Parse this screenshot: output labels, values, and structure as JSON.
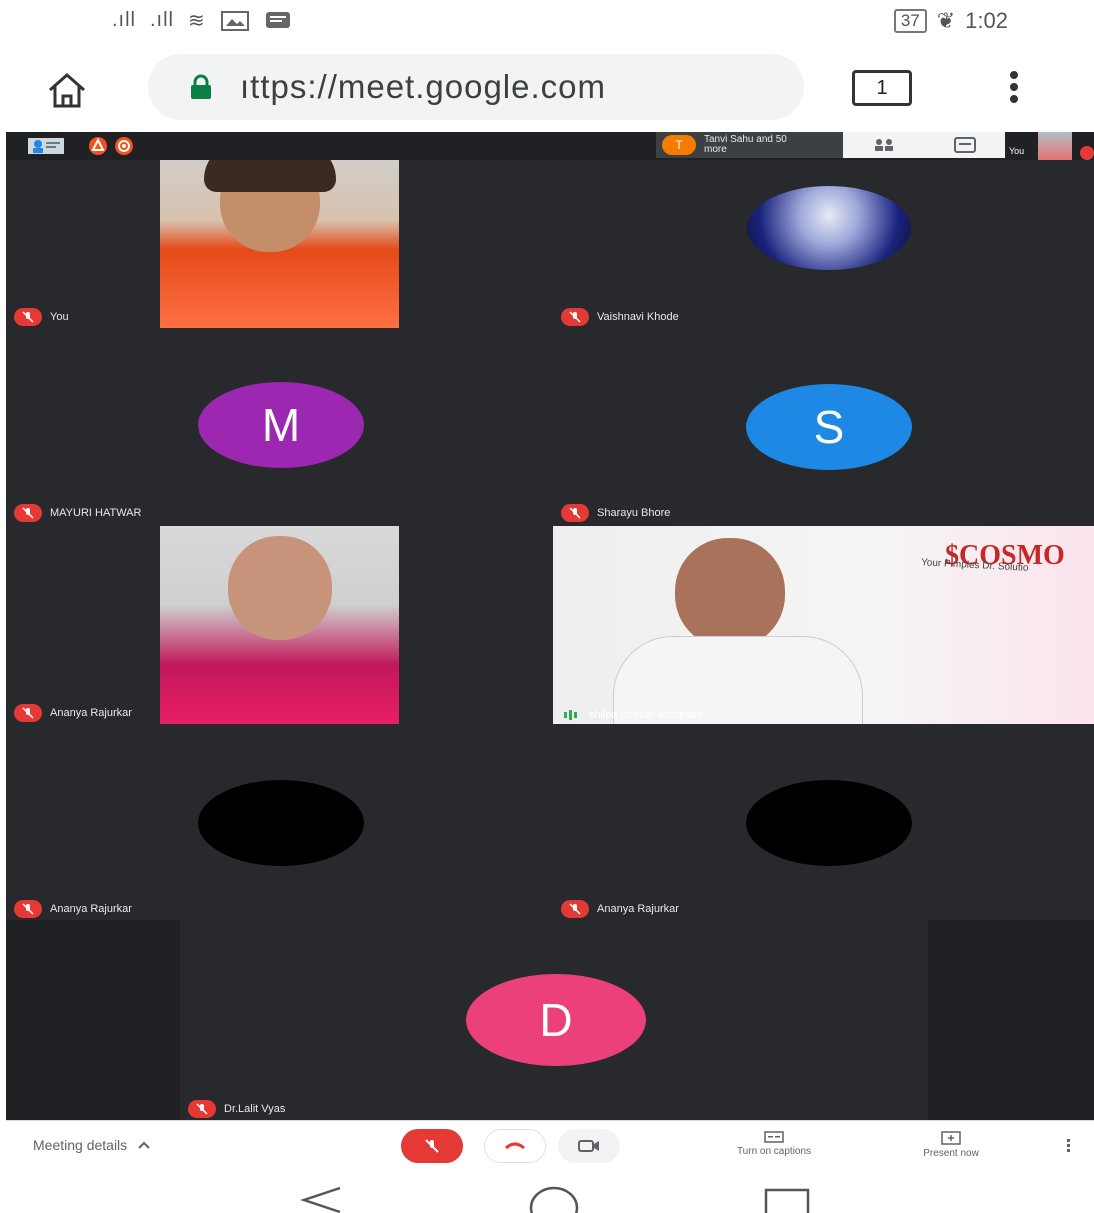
{
  "status": {
    "bars1": ".ıll",
    "bars2": ".ıll",
    "wifi": "≋",
    "battery": "37",
    "time": "1:02",
    "leaf": "❦"
  },
  "browser": {
    "url": "ıttps://meet.google.com",
    "tab_count": "1"
  },
  "header": {
    "participants_text": "Tanvi Sahu and 50 more",
    "participant_initial": "T",
    "self_label": "You"
  },
  "tiles": [
    {
      "name": "You",
      "type": "video"
    },
    {
      "name": "Vaishnavi Khode",
      "type": "image"
    },
    {
      "name": "MAYURI HATWAR",
      "type": "avatar",
      "initial": "M",
      "color": "#9c27b0"
    },
    {
      "name": "Sharayu Bhore",
      "type": "avatar",
      "initial": "S",
      "color": "#1e88e5"
    },
    {
      "name": "Ananya Rajurkar",
      "type": "video"
    },
    {
      "name": "shilpa bodkar Motghare",
      "type": "video"
    },
    {
      "name": "Ananya Rajurkar",
      "type": "avatar",
      "initial": "",
      "color": "#000000"
    },
    {
      "name": "Ananya Rajurkar",
      "type": "avatar",
      "initial": "",
      "color": "#000000"
    },
    {
      "name": "Dr.Lalit Vyas",
      "type": "avatar",
      "initial": "D",
      "color": "#ec407a"
    }
  ],
  "toolbar": {
    "meeting_details": "Meeting details",
    "captions": "Turn on captions",
    "present": "Present now"
  },
  "banner": {
    "cosmo": "$COSMO",
    "cosmo_sub": "Your Pimples Dr. Solutio"
  },
  "colors": {
    "meet_bg": "#202124",
    "tile_bg": "#28292d",
    "red": "#e53935",
    "avatar_m": "#9c27b0",
    "avatar_s": "#1e88e5",
    "avatar_d": "#ec407a"
  }
}
